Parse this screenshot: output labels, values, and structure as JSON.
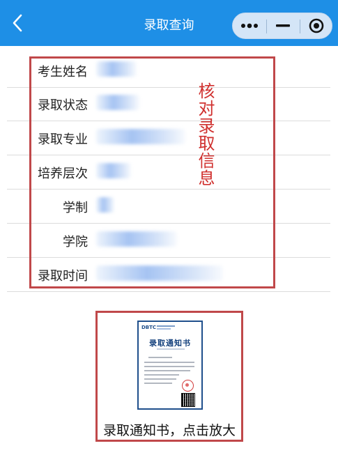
{
  "navbar": {
    "title": "录取查询",
    "back_icon": "chevron-left-icon",
    "more_icon": "more-dots-icon",
    "minimize_icon": "minimize-icon",
    "close_icon": "target-close-icon",
    "background_color": "#1e8fe6"
  },
  "fields": [
    {
      "label": "考生姓名",
      "value": ""
    },
    {
      "label": "录取状态",
      "value": ""
    },
    {
      "label": "录取专业",
      "value": ""
    },
    {
      "label": "培养层次",
      "value": ""
    },
    {
      "label": "学制",
      "value": ""
    },
    {
      "label": "学院",
      "value": ""
    },
    {
      "label": "录取时间",
      "value": ""
    }
  ],
  "annotation": {
    "text": "核对录取信息",
    "color": "#d0312f"
  },
  "admission_letter": {
    "logo_text": "DBTC",
    "thumbnail_title": "录取通知书",
    "caption": "录取通知书，点击放大"
  },
  "colors": {
    "highlight_border": "#c0484a",
    "divider": "#dcdcdc"
  }
}
